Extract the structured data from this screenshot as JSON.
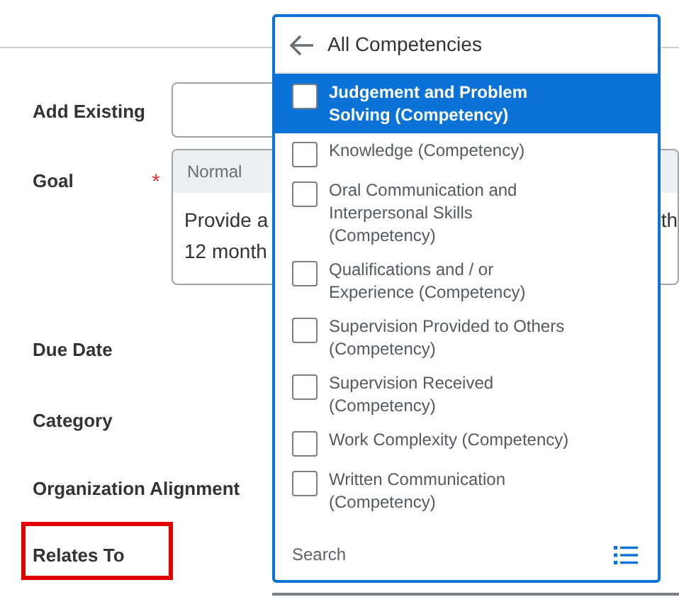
{
  "form": {
    "fields": [
      {
        "label": "Add Existing",
        "kind": "input",
        "required": false
      },
      {
        "label": "Goal",
        "kind": "goal",
        "required": true,
        "required_mark": "*",
        "editor": {
          "style": "Normal",
          "lines": [
            "Provide a",
            "12 month"
          ],
          "right_fragment": "th"
        }
      },
      {
        "label": "Due Date",
        "kind": "plain",
        "required": false
      },
      {
        "label": "Category",
        "kind": "plain",
        "required": false
      },
      {
        "label": "Organization Alignment",
        "kind": "plain",
        "required": false
      },
      {
        "label": "Relates To",
        "kind": "plain",
        "required": false,
        "highlighted": true
      }
    ]
  },
  "popup": {
    "title": "All Competencies",
    "items": [
      {
        "label": "Judgement and Problem Solving (Competency)",
        "selected": true,
        "checked": false
      },
      {
        "label": "Knowledge (Competency)",
        "selected": false,
        "checked": false
      },
      {
        "label": "Oral Communication and Interpersonal Skills (Competency)",
        "selected": false,
        "checked": false
      },
      {
        "label": "Qualifications and / or Experience (Competency)",
        "selected": false,
        "checked": false
      },
      {
        "label": "Supervision Provided to Others (Competency)",
        "selected": false,
        "checked": false
      },
      {
        "label": "Supervision Received (Competency)",
        "selected": false,
        "checked": false
      },
      {
        "label": "Work Complexity (Competency)",
        "selected": false,
        "checked": false
      },
      {
        "label": "Written Communication (Competency)",
        "selected": false,
        "checked": false
      }
    ],
    "search_placeholder": "Search"
  }
}
